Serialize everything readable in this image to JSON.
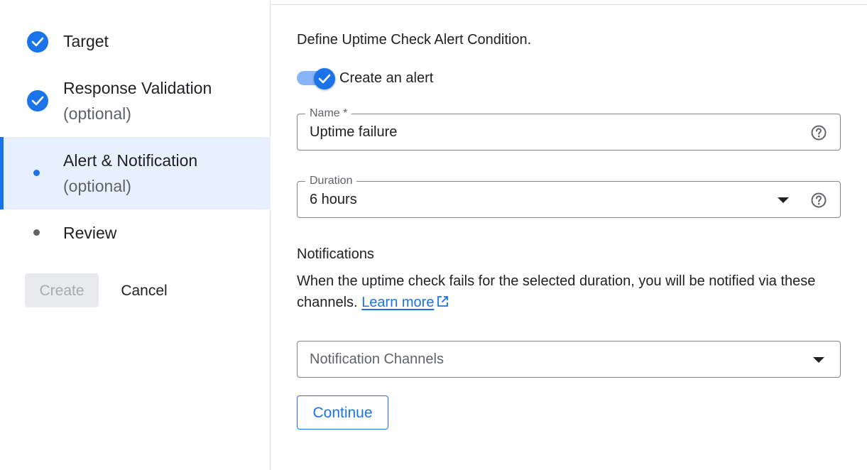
{
  "stepper": {
    "steps": [
      {
        "title": "Target",
        "subtitle": "",
        "state": "completed"
      },
      {
        "title": "Response Validation",
        "subtitle": "(optional)",
        "state": "completed"
      },
      {
        "title": "Alert & Notification",
        "subtitle": "(optional)",
        "state": "active"
      },
      {
        "title": "Review",
        "subtitle": "",
        "state": "pending"
      }
    ],
    "create_label": "Create",
    "cancel_label": "Cancel"
  },
  "form": {
    "heading": "Define Uptime Check Alert Condition.",
    "toggle_label": "Create an alert",
    "toggle_on": true,
    "name_field": {
      "label": "Name *",
      "value": "Uptime failure"
    },
    "duration_field": {
      "label": "Duration",
      "value": "6 hours"
    },
    "notifications": {
      "title": "Notifications",
      "description": "When the uptime check fails for the selected duration, you will be notified via these channels.",
      "learn_more": "Learn more"
    },
    "channels_placeholder": "Notification Channels",
    "continue_label": "Continue"
  },
  "colors": {
    "accent": "#1a73e8",
    "active_bg": "#e8f0fe",
    "border": "#80868b",
    "text": "#202124",
    "muted": "#5f6368"
  },
  "icons": [
    "check-icon",
    "help-icon",
    "dropdown-caret-icon",
    "external-link-icon"
  ]
}
